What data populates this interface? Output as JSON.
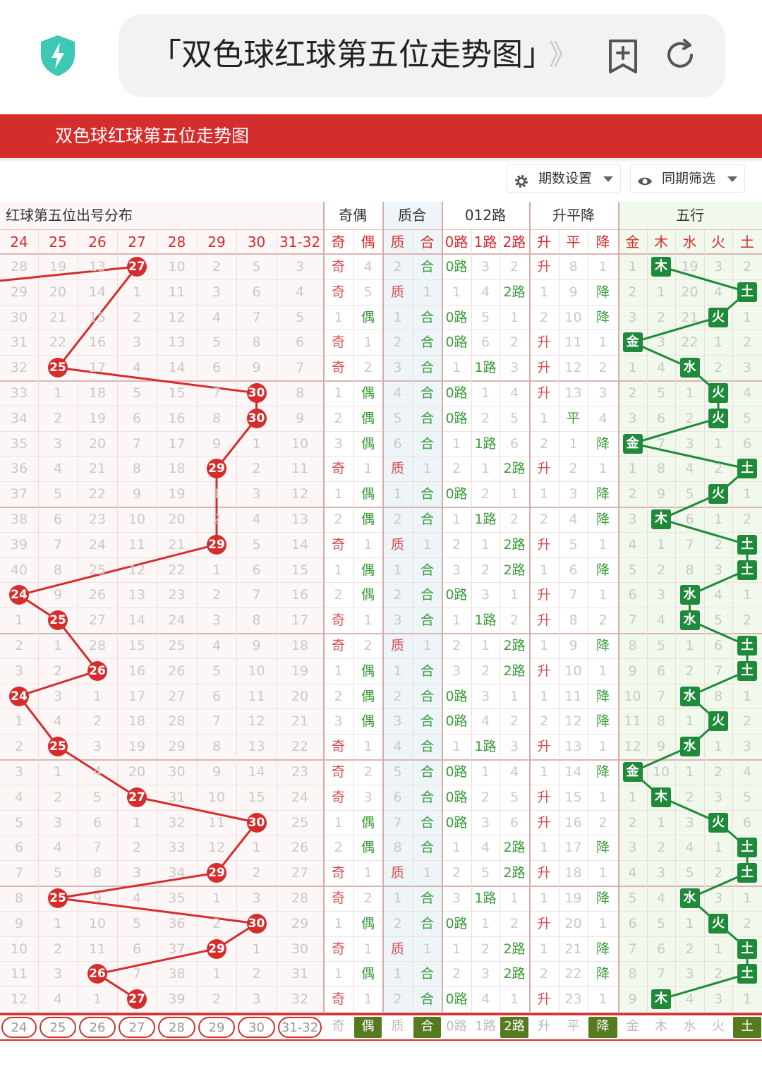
{
  "browser": {
    "url_text": "「双色球红球第五位走势图」",
    "url_overflow": "》",
    "icons": {
      "security": "shield-bolt-icon",
      "bookmark": "bookmark-add-icon",
      "reload": "reload-icon"
    }
  },
  "page": {
    "title": "双色球红球第五位走势图"
  },
  "filters": {
    "period_setting": {
      "label": "期数设置",
      "icon": "gear-icon"
    },
    "same_period": {
      "label": "同期筛选",
      "icon": "eye-icon"
    }
  },
  "colors": {
    "brand_red": "#d52c2c",
    "green_marker": "#1e8a3a",
    "odd_red": "#d95050",
    "even_green": "#3a9a3a"
  },
  "table": {
    "groups": [
      {
        "label": "红球第五位出号分布"
      },
      {
        "label": "奇偶"
      },
      {
        "label": "质合"
      },
      {
        "label": "012路"
      },
      {
        "label": "升平降"
      },
      {
        "label": "五行"
      }
    ],
    "dist_headers": [
      "24",
      "25",
      "26",
      "27",
      "28",
      "29",
      "30",
      "31-32"
    ],
    "sub_headers": [
      "奇",
      "偶",
      "质",
      "合",
      "0路",
      "1路",
      "2路",
      "升",
      "平",
      "降",
      "金",
      "木",
      "水",
      "火",
      "土"
    ],
    "rows": [
      {
        "d": [
          "28",
          "19",
          "13",
          "27",
          "10",
          "2",
          "5",
          "3"
        ],
        "hit": 3,
        "oe": [
          "奇",
          "4"
        ],
        "pc": [
          "2",
          "合"
        ],
        "r": [
          "0路",
          "3",
          "2"
        ],
        "t": [
          "升",
          "8",
          "1"
        ],
        "w": [
          "1",
          "木",
          "19",
          "3",
          "2"
        ],
        "wh": 1
      },
      {
        "d": [
          "29",
          "20",
          "14",
          "1",
          "11",
          "3",
          "6",
          "4"
        ],
        "hit": -1,
        "oe": [
          "奇",
          "5"
        ],
        "pc": [
          "质",
          "1"
        ],
        "r": [
          "1",
          "4",
          "2路"
        ],
        "t": [
          "1",
          "9",
          "降"
        ],
        "w": [
          "2",
          "1",
          "20",
          "4",
          "土"
        ],
        "wh": 4
      },
      {
        "d": [
          "30",
          "21",
          "15",
          "2",
          "12",
          "4",
          "7",
          "5"
        ],
        "hit": -1,
        "oe": [
          "1",
          "偶"
        ],
        "pc": [
          "1",
          "合"
        ],
        "r": [
          "0路",
          "5",
          "1"
        ],
        "t": [
          "2",
          "10",
          "降"
        ],
        "w": [
          "3",
          "2",
          "21",
          "火",
          "1"
        ],
        "wh": 3
      },
      {
        "d": [
          "31",
          "22",
          "16",
          "3",
          "13",
          "5",
          "8",
          "6"
        ],
        "hit": -1,
        "oe": [
          "奇",
          "1"
        ],
        "pc": [
          "2",
          "合"
        ],
        "r": [
          "0路",
          "6",
          "2"
        ],
        "t": [
          "升",
          "11",
          "1"
        ],
        "w": [
          "金",
          "3",
          "22",
          "1",
          "2"
        ],
        "wh": 0
      },
      {
        "d": [
          "32",
          "25",
          "17",
          "4",
          "14",
          "6",
          "9",
          "7"
        ],
        "hit": 1,
        "oe": [
          "奇",
          "2"
        ],
        "pc": [
          "3",
          "合"
        ],
        "r": [
          "1",
          "1路",
          "3"
        ],
        "t": [
          "升",
          "12",
          "2"
        ],
        "w": [
          "1",
          "4",
          "水",
          "2",
          "3"
        ],
        "wh": 2
      },
      {
        "d": [
          "33",
          "1",
          "18",
          "5",
          "15",
          "7",
          "30",
          "8"
        ],
        "hit": 6,
        "oe": [
          "1",
          "偶"
        ],
        "pc": [
          "4",
          "合"
        ],
        "r": [
          "0路",
          "1",
          "4"
        ],
        "t": [
          "升",
          "13",
          "3"
        ],
        "w": [
          "2",
          "5",
          "1",
          "火",
          "4"
        ],
        "wh": 3
      },
      {
        "d": [
          "34",
          "2",
          "19",
          "6",
          "16",
          "8",
          "30",
          "9"
        ],
        "hit": 6,
        "oe": [
          "2",
          "偶"
        ],
        "pc": [
          "5",
          "合"
        ],
        "r": [
          "0路",
          "2",
          "5"
        ],
        "t": [
          "1",
          "平",
          "4"
        ],
        "w": [
          "3",
          "6",
          "2",
          "火",
          "5"
        ],
        "wh": 3
      },
      {
        "d": [
          "35",
          "3",
          "20",
          "7",
          "17",
          "9",
          "1",
          "10"
        ],
        "hit": -1,
        "oe": [
          "3",
          "偶"
        ],
        "pc": [
          "6",
          "合"
        ],
        "r": [
          "1",
          "1路",
          "6"
        ],
        "t": [
          "2",
          "1",
          "降"
        ],
        "w": [
          "金",
          "7",
          "3",
          "1",
          "6"
        ],
        "wh": 0
      },
      {
        "d": [
          "36",
          "4",
          "21",
          "8",
          "18",
          "29",
          "2",
          "11"
        ],
        "hit": 5,
        "oe": [
          "奇",
          "1"
        ],
        "pc": [
          "质",
          "1"
        ],
        "r": [
          "2",
          "1",
          "2路"
        ],
        "t": [
          "升",
          "2",
          "1"
        ],
        "w": [
          "1",
          "8",
          "4",
          "2",
          "土"
        ],
        "wh": 4
      },
      {
        "d": [
          "37",
          "5",
          "22",
          "9",
          "19",
          "1",
          "3",
          "12"
        ],
        "hit": -1,
        "oe": [
          "1",
          "偶"
        ],
        "pc": [
          "1",
          "合"
        ],
        "r": [
          "0路",
          "2",
          "1"
        ],
        "t": [
          "1",
          "3",
          "降"
        ],
        "w": [
          "2",
          "9",
          "5",
          "火",
          "1"
        ],
        "wh": 3
      },
      {
        "d": [
          "38",
          "6",
          "23",
          "10",
          "20",
          "2",
          "4",
          "13"
        ],
        "hit": -1,
        "oe": [
          "2",
          "偶"
        ],
        "pc": [
          "2",
          "合"
        ],
        "r": [
          "1",
          "1路",
          "2"
        ],
        "t": [
          "2",
          "4",
          "降"
        ],
        "w": [
          "3",
          "木",
          "6",
          "1",
          "2"
        ],
        "wh": 1
      },
      {
        "d": [
          "39",
          "7",
          "24",
          "11",
          "21",
          "29",
          "5",
          "14"
        ],
        "hit": 5,
        "oe": [
          "奇",
          "1"
        ],
        "pc": [
          "质",
          "1"
        ],
        "r": [
          "2",
          "1",
          "2路"
        ],
        "t": [
          "升",
          "5",
          "1"
        ],
        "w": [
          "4",
          "1",
          "7",
          "2",
          "土"
        ],
        "wh": 4
      },
      {
        "d": [
          "40",
          "8",
          "25",
          "12",
          "22",
          "1",
          "6",
          "15"
        ],
        "hit": -1,
        "oe": [
          "1",
          "偶"
        ],
        "pc": [
          "1",
          "合"
        ],
        "r": [
          "3",
          "2",
          "2路"
        ],
        "t": [
          "1",
          "6",
          "降"
        ],
        "w": [
          "5",
          "2",
          "8",
          "3",
          "土"
        ],
        "wh": 4
      },
      {
        "d": [
          "24",
          "9",
          "26",
          "13",
          "23",
          "2",
          "7",
          "16"
        ],
        "hit": 0,
        "oe": [
          "2",
          "偶"
        ],
        "pc": [
          "2",
          "合"
        ],
        "r": [
          "0路",
          "3",
          "1"
        ],
        "t": [
          "升",
          "7",
          "1"
        ],
        "w": [
          "6",
          "3",
          "水",
          "4",
          "1"
        ],
        "wh": 2
      },
      {
        "d": [
          "1",
          "25",
          "27",
          "14",
          "24",
          "3",
          "8",
          "17"
        ],
        "hit": 1,
        "oe": [
          "奇",
          "1"
        ],
        "pc": [
          "3",
          "合"
        ],
        "r": [
          "1",
          "1路",
          "2"
        ],
        "t": [
          "升",
          "8",
          "2"
        ],
        "w": [
          "7",
          "4",
          "水",
          "5",
          "2"
        ],
        "wh": 2
      },
      {
        "d": [
          "2",
          "1",
          "28",
          "15",
          "25",
          "4",
          "9",
          "18"
        ],
        "hit": -1,
        "oe": [
          "奇",
          "2"
        ],
        "pc": [
          "质",
          "1"
        ],
        "r": [
          "2",
          "1",
          "2路"
        ],
        "t": [
          "1",
          "9",
          "降"
        ],
        "w": [
          "8",
          "5",
          "1",
          "6",
          "土"
        ],
        "wh": 4
      },
      {
        "d": [
          "3",
          "2",
          "26",
          "16",
          "26",
          "5",
          "10",
          "19"
        ],
        "hit": 2,
        "oe": [
          "1",
          "偶"
        ],
        "pc": [
          "1",
          "合"
        ],
        "r": [
          "3",
          "2",
          "2路"
        ],
        "t": [
          "升",
          "10",
          "1"
        ],
        "w": [
          "9",
          "6",
          "2",
          "7",
          "土"
        ],
        "wh": 4
      },
      {
        "d": [
          "24",
          "3",
          "1",
          "17",
          "27",
          "6",
          "11",
          "20"
        ],
        "hit": 0,
        "oe": [
          "2",
          "偶"
        ],
        "pc": [
          "2",
          "合"
        ],
        "r": [
          "0路",
          "3",
          "1"
        ],
        "t": [
          "1",
          "11",
          "降"
        ],
        "w": [
          "10",
          "7",
          "水",
          "8",
          "1"
        ],
        "wh": 2
      },
      {
        "d": [
          "1",
          "4",
          "2",
          "18",
          "28",
          "7",
          "12",
          "21"
        ],
        "hit": -1,
        "oe": [
          "3",
          "偶"
        ],
        "pc": [
          "3",
          "合"
        ],
        "r": [
          "0路",
          "4",
          "2"
        ],
        "t": [
          "2",
          "12",
          "降"
        ],
        "w": [
          "11",
          "8",
          "1",
          "火",
          "2"
        ],
        "wh": 3
      },
      {
        "d": [
          "2",
          "25",
          "3",
          "19",
          "29",
          "8",
          "13",
          "22"
        ],
        "hit": 1,
        "oe": [
          "奇",
          "1"
        ],
        "pc": [
          "4",
          "合"
        ],
        "r": [
          "1",
          "1路",
          "3"
        ],
        "t": [
          "升",
          "13",
          "1"
        ],
        "w": [
          "12",
          "9",
          "水",
          "1",
          "3"
        ],
        "wh": 2
      },
      {
        "d": [
          "3",
          "1",
          "4",
          "20",
          "30",
          "9",
          "14",
          "23"
        ],
        "hit": -1,
        "oe": [
          "奇",
          "2"
        ],
        "pc": [
          "5",
          "合"
        ],
        "r": [
          "0路",
          "1",
          "4"
        ],
        "t": [
          "1",
          "14",
          "降"
        ],
        "w": [
          "金",
          "10",
          "1",
          "2",
          "4"
        ],
        "wh": 0
      },
      {
        "d": [
          "4",
          "2",
          "5",
          "27",
          "31",
          "10",
          "15",
          "24"
        ],
        "hit": 3,
        "oe": [
          "奇",
          "3"
        ],
        "pc": [
          "6",
          "合"
        ],
        "r": [
          "0路",
          "2",
          "5"
        ],
        "t": [
          "升",
          "15",
          "1"
        ],
        "w": [
          "1",
          "木",
          "2",
          "3",
          "5"
        ],
        "wh": 1
      },
      {
        "d": [
          "5",
          "3",
          "6",
          "1",
          "32",
          "11",
          "30",
          "25"
        ],
        "hit": 6,
        "oe": [
          "1",
          "偶"
        ],
        "pc": [
          "7",
          "合"
        ],
        "r": [
          "0路",
          "3",
          "6"
        ],
        "t": [
          "升",
          "16",
          "2"
        ],
        "w": [
          "2",
          "1",
          "3",
          "火",
          "6"
        ],
        "wh": 3
      },
      {
        "d": [
          "6",
          "4",
          "7",
          "2",
          "33",
          "12",
          "1",
          "26"
        ],
        "hit": -1,
        "oe": [
          "2",
          "偶"
        ],
        "pc": [
          "8",
          "合"
        ],
        "r": [
          "1",
          "4",
          "2路"
        ],
        "t": [
          "1",
          "17",
          "降"
        ],
        "w": [
          "3",
          "2",
          "4",
          "1",
          "土"
        ],
        "wh": 4
      },
      {
        "d": [
          "7",
          "5",
          "8",
          "3",
          "34",
          "29",
          "2",
          "27"
        ],
        "hit": 5,
        "oe": [
          "奇",
          "1"
        ],
        "pc": [
          "质",
          "1"
        ],
        "r": [
          "2",
          "5",
          "2路"
        ],
        "t": [
          "升",
          "18",
          "1"
        ],
        "w": [
          "4",
          "3",
          "5",
          "2",
          "土"
        ],
        "wh": 4
      },
      {
        "d": [
          "8",
          "25",
          "9",
          "4",
          "35",
          "1",
          "3",
          "28"
        ],
        "hit": 1,
        "oe": [
          "奇",
          "2"
        ],
        "pc": [
          "1",
          "合"
        ],
        "r": [
          "3",
          "1路",
          "1"
        ],
        "t": [
          "1",
          "19",
          "降"
        ],
        "w": [
          "5",
          "4",
          "水",
          "3",
          "1"
        ],
        "wh": 2
      },
      {
        "d": [
          "9",
          "1",
          "10",
          "5",
          "36",
          "2",
          "30",
          "29"
        ],
        "hit": 6,
        "oe": [
          "1",
          "偶"
        ],
        "pc": [
          "2",
          "合"
        ],
        "r": [
          "0路",
          "1",
          "2"
        ],
        "t": [
          "升",
          "20",
          "1"
        ],
        "w": [
          "6",
          "5",
          "1",
          "火",
          "2"
        ],
        "wh": 3
      },
      {
        "d": [
          "10",
          "2",
          "11",
          "6",
          "37",
          "29",
          "1",
          "30"
        ],
        "hit": 5,
        "oe": [
          "奇",
          "1"
        ],
        "pc": [
          "质",
          "1"
        ],
        "r": [
          "1",
          "2",
          "2路"
        ],
        "t": [
          "1",
          "21",
          "降"
        ],
        "w": [
          "7",
          "6",
          "2",
          "1",
          "土"
        ],
        "wh": 4
      },
      {
        "d": [
          "11",
          "3",
          "26",
          "7",
          "38",
          "1",
          "2",
          "31"
        ],
        "hit": 2,
        "oe": [
          "1",
          "偶"
        ],
        "pc": [
          "1",
          "合"
        ],
        "r": [
          "2",
          "3",
          "2路"
        ],
        "t": [
          "2",
          "22",
          "降"
        ],
        "w": [
          "8",
          "7",
          "3",
          "2",
          "土"
        ],
        "wh": 4
      },
      {
        "d": [
          "12",
          "4",
          "1",
          "27",
          "39",
          "2",
          "3",
          "32"
        ],
        "hit": 3,
        "oe": [
          "奇",
          "1"
        ],
        "pc": [
          "2",
          "合"
        ],
        "r": [
          "0路",
          "4",
          "1"
        ],
        "t": [
          "升",
          "23",
          "1"
        ],
        "w": [
          "9",
          "木",
          "4",
          "3",
          "1"
        ],
        "wh": 1
      }
    ],
    "footer": {
      "dist": [
        "24",
        "25",
        "26",
        "27",
        "28",
        "29",
        "30",
        "31-32"
      ],
      "attrs": [
        "奇",
        "偶",
        "质",
        "合",
        "0路",
        "1路",
        "2路",
        "升",
        "平",
        "降",
        "金",
        "木",
        "水",
        "火",
        "土"
      ],
      "selected": [
        "偶",
        "合",
        "2路",
        "降",
        "土"
      ]
    }
  }
}
